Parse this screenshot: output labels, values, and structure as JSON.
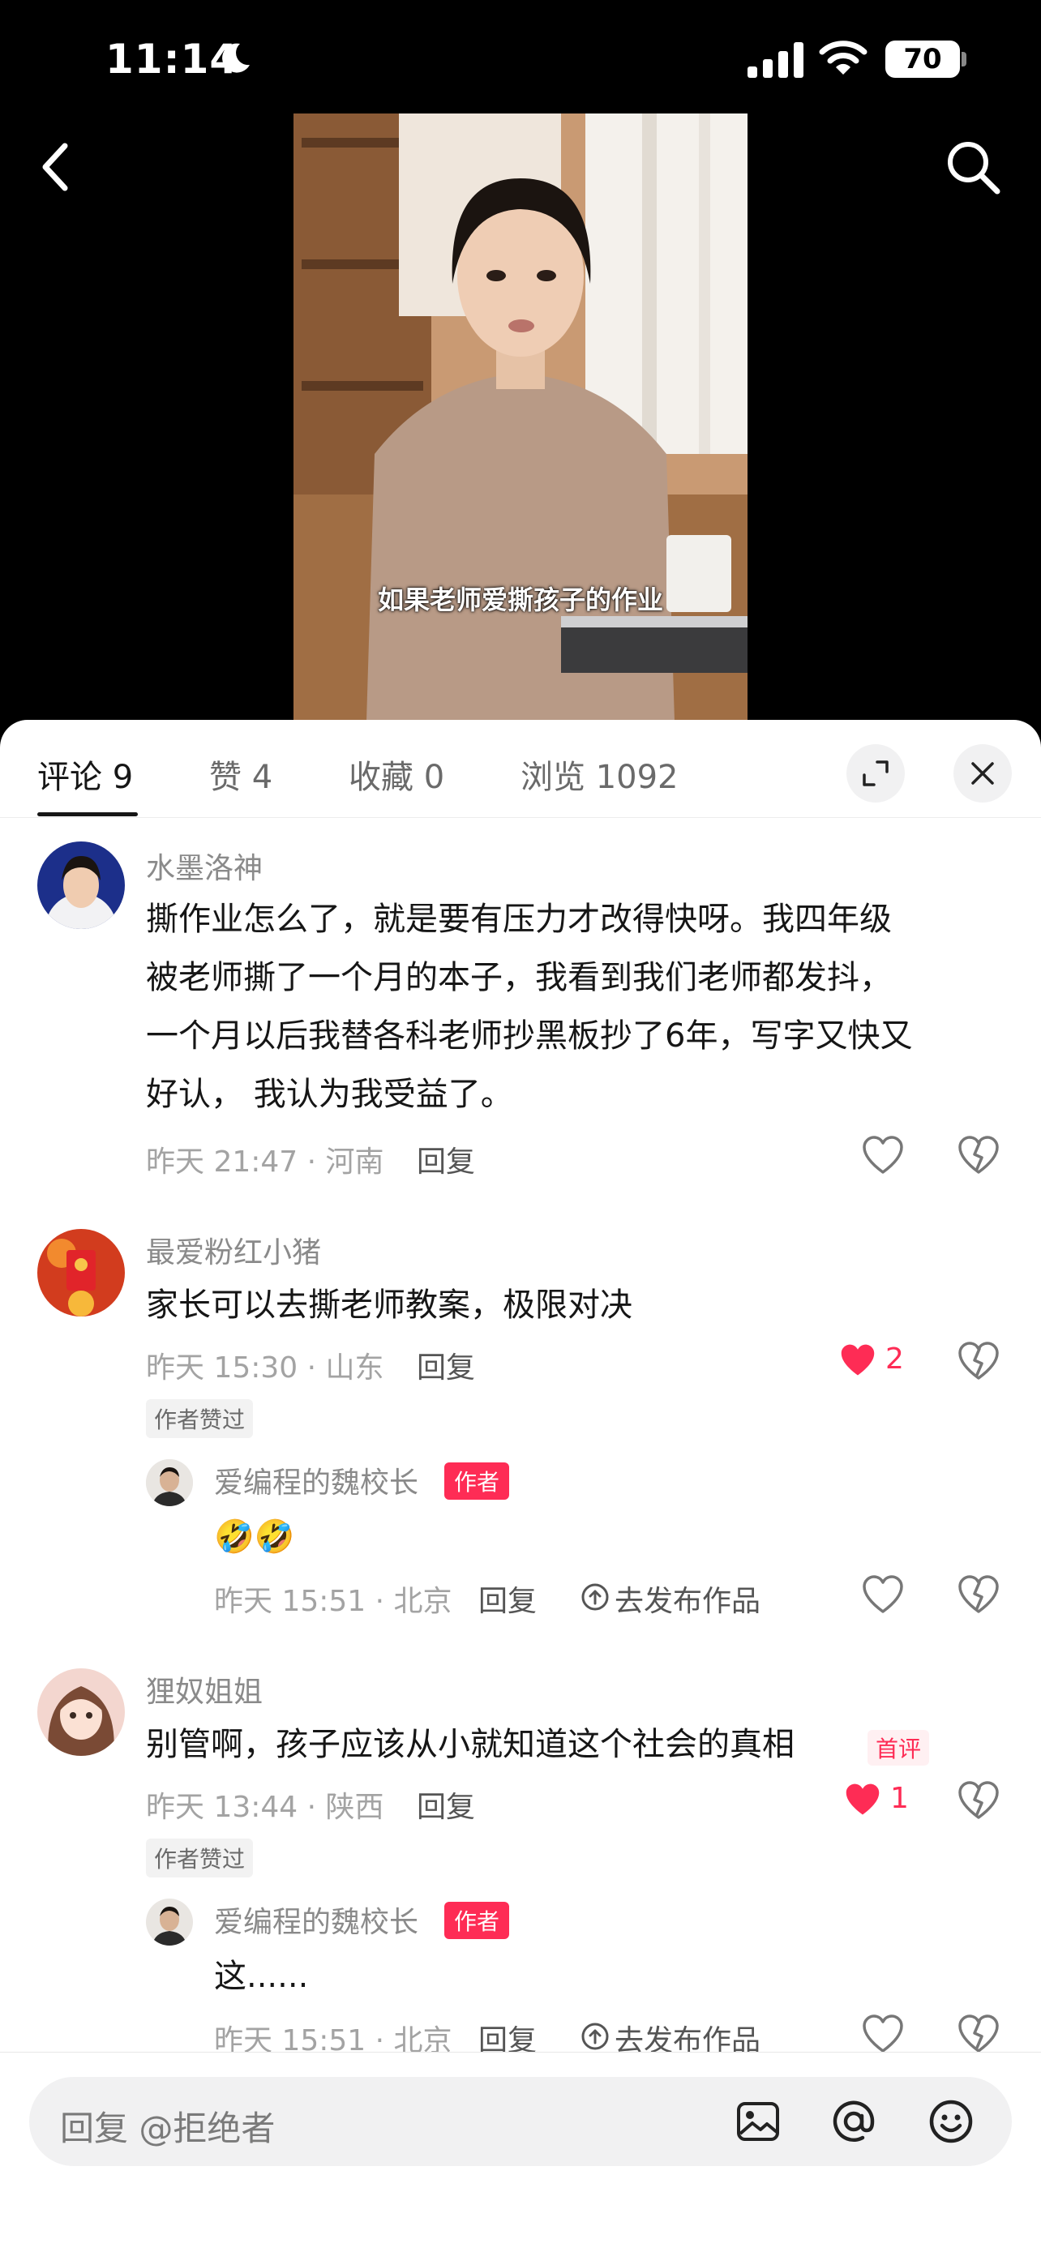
{
  "status_bar": {
    "time": "11:14",
    "battery": "70"
  },
  "video": {
    "subtitle": "如果老师爱撕孩子的作业"
  },
  "tabs": [
    {
      "label": "评论 9",
      "active": true
    },
    {
      "label": "赞 4"
    },
    {
      "label": "收藏 0"
    },
    {
      "label": "浏览 1092"
    }
  ],
  "comments": [
    {
      "user": "水墨洛神",
      "lines": [
        "撕作业怎么了，就是要有压力才改得快呀。我四年级",
        "被老师撕了一个月的本子，我看到我们老师都发抖，",
        "一个月以后我替各科老师抄黑板抄了6年，写字又快又",
        "好认， 我认为我受益了。"
      ],
      "meta": "昨天 21:47 · 河南",
      "reply": "回复"
    },
    {
      "user": "最爱粉红小猪",
      "lines": [
        "家长可以去撕老师教案，极限对决"
      ],
      "meta": "昨天 15:30 · 山东",
      "reply": "回复",
      "likes": "2",
      "author_liked": "作者赞过",
      "sub_reply": {
        "user": "爱编程的魏校长",
        "badge": "作者",
        "text": "🤣🤣",
        "meta": "昨天 15:51 · 北京",
        "reply": "回复",
        "publish": "去发布作品"
      }
    },
    {
      "user": "狸奴姐姐",
      "lines": [
        "别管啊，孩子应该从小就知道这个社会的真相"
      ],
      "first_badge": "首评",
      "meta": "昨天 13:44 · 陕西",
      "reply": "回复",
      "likes": "1",
      "author_liked": "作者赞过",
      "sub_reply": {
        "user": "爱编程的魏校长",
        "badge": "作者",
        "text": "这......",
        "meta": "昨天 15:51 · 北京",
        "reply": "回复",
        "publish": "去发布作品"
      }
    }
  ],
  "input": {
    "placeholder": "回复 @拒绝者"
  },
  "colors": {
    "accent": "#fe2c55",
    "background": "#ffffff",
    "text": "#161616"
  }
}
